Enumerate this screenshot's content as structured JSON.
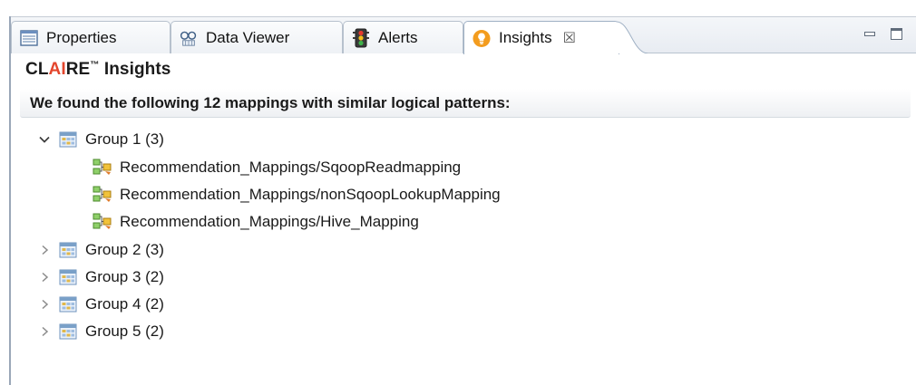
{
  "tabs": [
    {
      "label": "Properties",
      "icon": "properties-icon",
      "active": false
    },
    {
      "label": "Data Viewer",
      "icon": "data-viewer-icon",
      "active": false
    },
    {
      "label": "Alerts",
      "icon": "alerts-icon",
      "active": false
    },
    {
      "label": "Insights",
      "icon": "insights-icon",
      "active": true,
      "close": "☒"
    }
  ],
  "panel": {
    "brand_pre": "CL",
    "brand_ai": "AI",
    "brand_post": "RE",
    "brand_tm": "™",
    "brand_suffix": " Insights",
    "banner": "We found the following 12 mappings with similar logical patterns:"
  },
  "tree": {
    "groups": [
      {
        "label": "Group 1 (3)",
        "expanded": true,
        "children": [
          "Recommendation_Mappings/SqoopReadmapping",
          "Recommendation_Mappings/nonSqoopLookupMapping",
          "Recommendation_Mappings/Hive_Mapping"
        ]
      },
      {
        "label": "Group 2 (3)",
        "expanded": false
      },
      {
        "label": "Group 3 (2)",
        "expanded": false
      },
      {
        "label": "Group 4 (2)",
        "expanded": false
      },
      {
        "label": "Group 5 (2)",
        "expanded": false
      }
    ]
  },
  "colors": {
    "accent_ai": "#e4462d",
    "insights_icon": "#f39c1e",
    "group_icon": "#7aa0c8"
  }
}
